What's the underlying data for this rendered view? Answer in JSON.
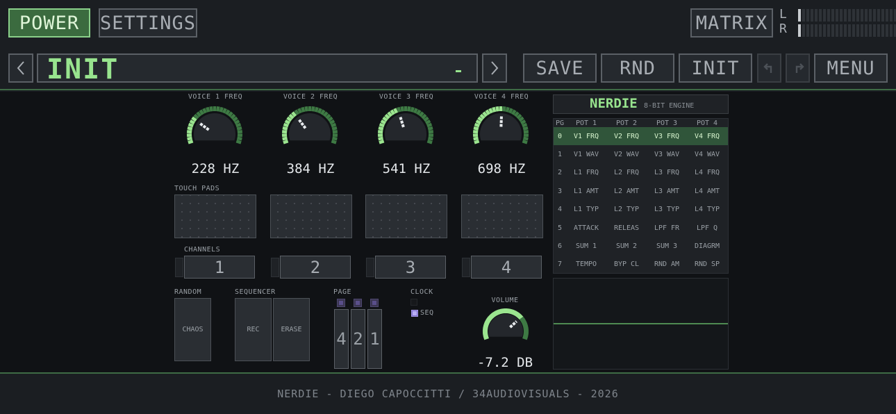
{
  "header": {
    "power_label": "POWER",
    "settings_label": "SETTINGS",
    "matrix_label": "MATRIX",
    "meter": {
      "left_label": "L",
      "right_label": "R",
      "left_level": 0.04,
      "right_level": 0.04
    }
  },
  "preset_bar": {
    "prev_icon": "chevron-left-icon",
    "preset_name": "INIT",
    "next_icon": "chevron-right-icon",
    "save_label": "SAVE",
    "rnd_label": "RND",
    "init_label": "INIT",
    "undo_icon": "undo-icon",
    "redo_icon": "redo-icon",
    "menu_label": "MENU"
  },
  "voices": [
    {
      "label": "VOICE 1 FREQ",
      "value": "228 HZ",
      "level": 0.25
    },
    {
      "label": "VOICE 2 FREQ",
      "value": "384 HZ",
      "level": 0.33
    },
    {
      "label": "VOICE 3 FREQ",
      "value": "541 HZ",
      "level": 0.42
    },
    {
      "label": "VOICE 4 FREQ",
      "value": "698 HZ",
      "level": 0.51
    }
  ],
  "touch_pads": {
    "label": "TOUCH PADS"
  },
  "channels": {
    "label": "CHANNELS",
    "items": [
      "1",
      "2",
      "3",
      "4"
    ]
  },
  "random": {
    "label": "RANDOM",
    "chaos_label": "CHAOS"
  },
  "sequencer": {
    "label": "SEQUENCER",
    "rec_label": "REC",
    "erase_label": "ERASE"
  },
  "page": {
    "label": "PAGE",
    "digits": [
      "4",
      "2",
      "1"
    ]
  },
  "clock": {
    "label": "CLOCK",
    "seq_label": "SEQ"
  },
  "volume": {
    "label": "VOLUME",
    "value": "-7.2 DB",
    "level": 0.72
  },
  "engine": {
    "name": "NERDIE",
    "subtitle": "8-BIT ENGINE"
  },
  "matrix": {
    "headers": [
      "PG",
      "POT 1",
      "POT 2",
      "POT 3",
      "POT 4"
    ],
    "rows": [
      [
        "0",
        "V1 FRQ",
        "V2 FRQ",
        "V3 FRQ",
        "V4 FRQ"
      ],
      [
        "1",
        "V1 WAV",
        "V2 WAV",
        "V3 WAV",
        "V4 WAV"
      ],
      [
        "2",
        "L1 FRQ",
        "L2 FRQ",
        "L3 FRQ",
        "L4 FRQ"
      ],
      [
        "3",
        "L1 AMT",
        "L2 AMT",
        "L3 AMT",
        "L4 AMT"
      ],
      [
        "4",
        "L1 TYP",
        "L2 TYP",
        "L3 TYP",
        "L4 TYP"
      ],
      [
        "5",
        "ATTACK",
        "RELEAS",
        "LPF FR",
        "LPF Q"
      ],
      [
        "6",
        "SUM 1",
        "SUM 2",
        "SUM 3",
        "DIAGRM"
      ],
      [
        "7",
        "TEMPO",
        "BYP CL",
        "RND AM",
        "RND SP"
      ]
    ],
    "active_row": 0
  },
  "colors": {
    "accent": "#98e48e",
    "accent_dark": "#3b6b3f",
    "seq_led": "#7c6cc8"
  },
  "footer": {
    "text": "NERDIE - DIEGO CAPOCCITTI / 34AUDIOVISUALS - 2026"
  }
}
